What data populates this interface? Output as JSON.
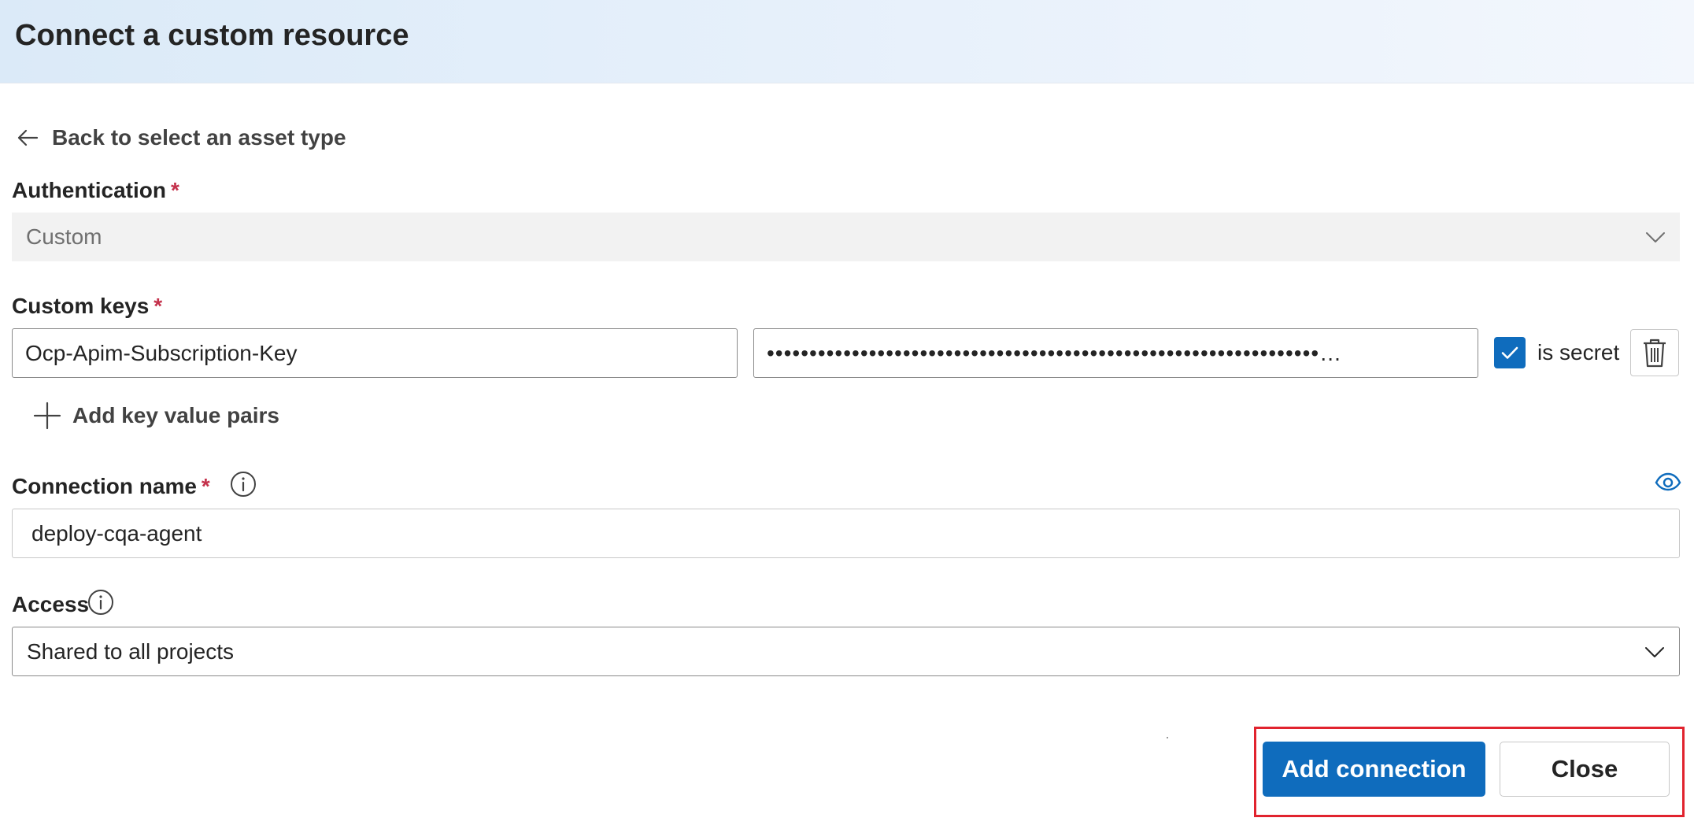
{
  "dialog": {
    "title": "Connect a custom resource"
  },
  "back_link": {
    "label": "Back to select an asset type"
  },
  "authentication": {
    "label": "Authentication",
    "required_mark": "*",
    "value": "Custom"
  },
  "custom_keys": {
    "label": "Custom keys",
    "required_mark": "*",
    "key_value": "Ocp-Apim-Subscription-Key",
    "secret_value": "•••••••••••••••••••••••••••••••••••••••••••••••••••••••••••••••••…",
    "is_secret_label": "is secret",
    "is_secret_checked": true,
    "add_pairs_label": "Add key value pairs"
  },
  "connection_name": {
    "label": "Connection name",
    "required_mark": "*",
    "value": "deploy-cqa-agent"
  },
  "access": {
    "label": "Access",
    "value": "Shared to all projects"
  },
  "footer": {
    "add_connection_label": "Add connection",
    "close_label": "Close"
  },
  "colors": {
    "primary": "#0f6cbd",
    "required": "#c4314b",
    "highlight": "#e1232e"
  }
}
